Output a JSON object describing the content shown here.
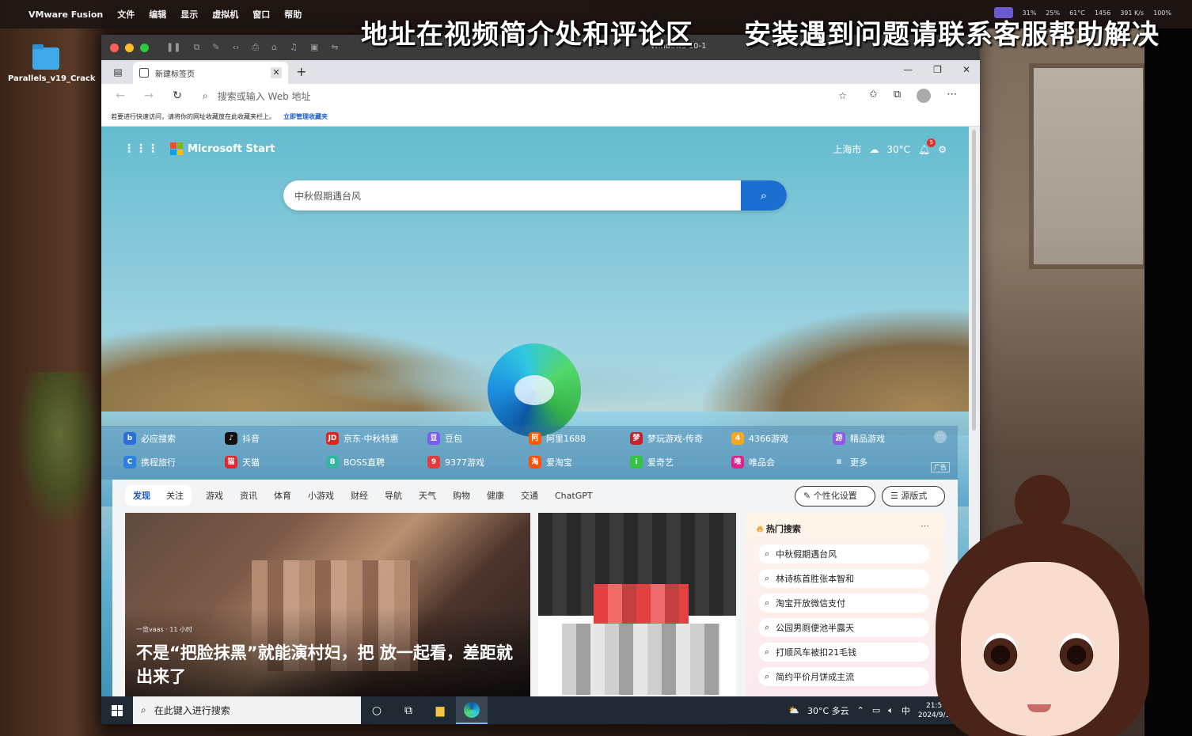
{
  "overlay": {
    "left_text": "地址在视频简介处和评论区",
    "right_text": "安装遇到问题请联系客服帮助解决"
  },
  "mac_menu": {
    "apple": "",
    "items": [
      "VMware Fusion",
      "文件",
      "编辑",
      "显示",
      "虚拟机",
      "窗口",
      "帮助"
    ],
    "status": [
      "31%",
      "25%",
      "61°C",
      "1456",
      "391 K/s",
      "100%"
    ]
  },
  "desktop_icons": [
    {
      "label": "Parallels_v19_Crack"
    }
  ],
  "vm": {
    "title": "Windows 10-1"
  },
  "browser": {
    "tab_title": "新建标签页",
    "address_placeholder": "搜索或输入 Web 地址",
    "favbar_text": "若要进行快速访问，请将你的网址收藏放在此收藏夹栏上。",
    "favbar_link": "立即管理收藏夹"
  },
  "ntp": {
    "brand": "Microsoft Start",
    "city": "上海市",
    "temp": "30°C",
    "notif_count": "5",
    "search_value": "中秋假期遇台风",
    "quicklinks": [
      {
        "label": "必应搜索",
        "color": "#2b6fd6",
        "glyph": "b"
      },
      {
        "label": "抖音",
        "color": "#111111",
        "glyph": "♪"
      },
      {
        "label": "京东·中秋特惠",
        "color": "#e1251b",
        "glyph": "JD"
      },
      {
        "label": "豆包",
        "color": "#7a5cf0",
        "glyph": "豆"
      },
      {
        "label": "阿里1688",
        "color": "#ff5a00",
        "glyph": "阿"
      },
      {
        "label": "梦玩游戏-传奇",
        "color": "#c0262d",
        "glyph": "梦"
      },
      {
        "label": "4366游戏",
        "color": "#f5a623",
        "glyph": "4"
      },
      {
        "label": "精品游戏",
        "color": "#8e59e8",
        "glyph": "游"
      },
      {
        "label": "携程旅行",
        "color": "#2f7fe0",
        "glyph": "C"
      },
      {
        "label": "天猫",
        "color": "#e3262e",
        "glyph": "猫"
      },
      {
        "label": "BOSS直聘",
        "color": "#2fb6a4",
        "glyph": "B"
      },
      {
        "label": "9377游戏",
        "color": "#e23c3c",
        "glyph": "9"
      },
      {
        "label": "爱淘宝",
        "color": "#ff4f00",
        "glyph": "淘"
      },
      {
        "label": "爱奇艺",
        "color": "#35c343",
        "glyph": "i"
      },
      {
        "label": "唯品会",
        "color": "#e0218a",
        "glyph": "唯"
      },
      {
        "label": "更多",
        "color": "transparent",
        "glyph": "≡"
      }
    ],
    "ad_tag": "广告",
    "feed_tabs_active": [
      "发现",
      "关注"
    ],
    "feed_categories": [
      "游戏",
      "资讯",
      "体育",
      "小游戏",
      "财经",
      "导航",
      "天气",
      "购物",
      "健康",
      "交通",
      "ChatGPT"
    ],
    "btn_personalize": "个性化设置",
    "btn_layout": "源版式",
    "big_card": {
      "source": "一览vaas · 11 小时",
      "headline": "不是“把脸抹黑”就能演村妇，把 放一起看，差距就出来了"
    },
    "hot": {
      "title": "热门搜索",
      "items": [
        "中秋假期遇台风",
        "林诗栋首胜张本智和",
        "淘宝开放微信支付",
        "公园男厕便池半露天",
        "打顺风车被扣21毛钱",
        "简约平价月饼成主流"
      ]
    }
  },
  "taskbar": {
    "search_placeholder": "在此键入进行搜索",
    "weather": "30°C 多云",
    "ime": "中",
    "time": "21:54",
    "date": "2024/9/12"
  }
}
